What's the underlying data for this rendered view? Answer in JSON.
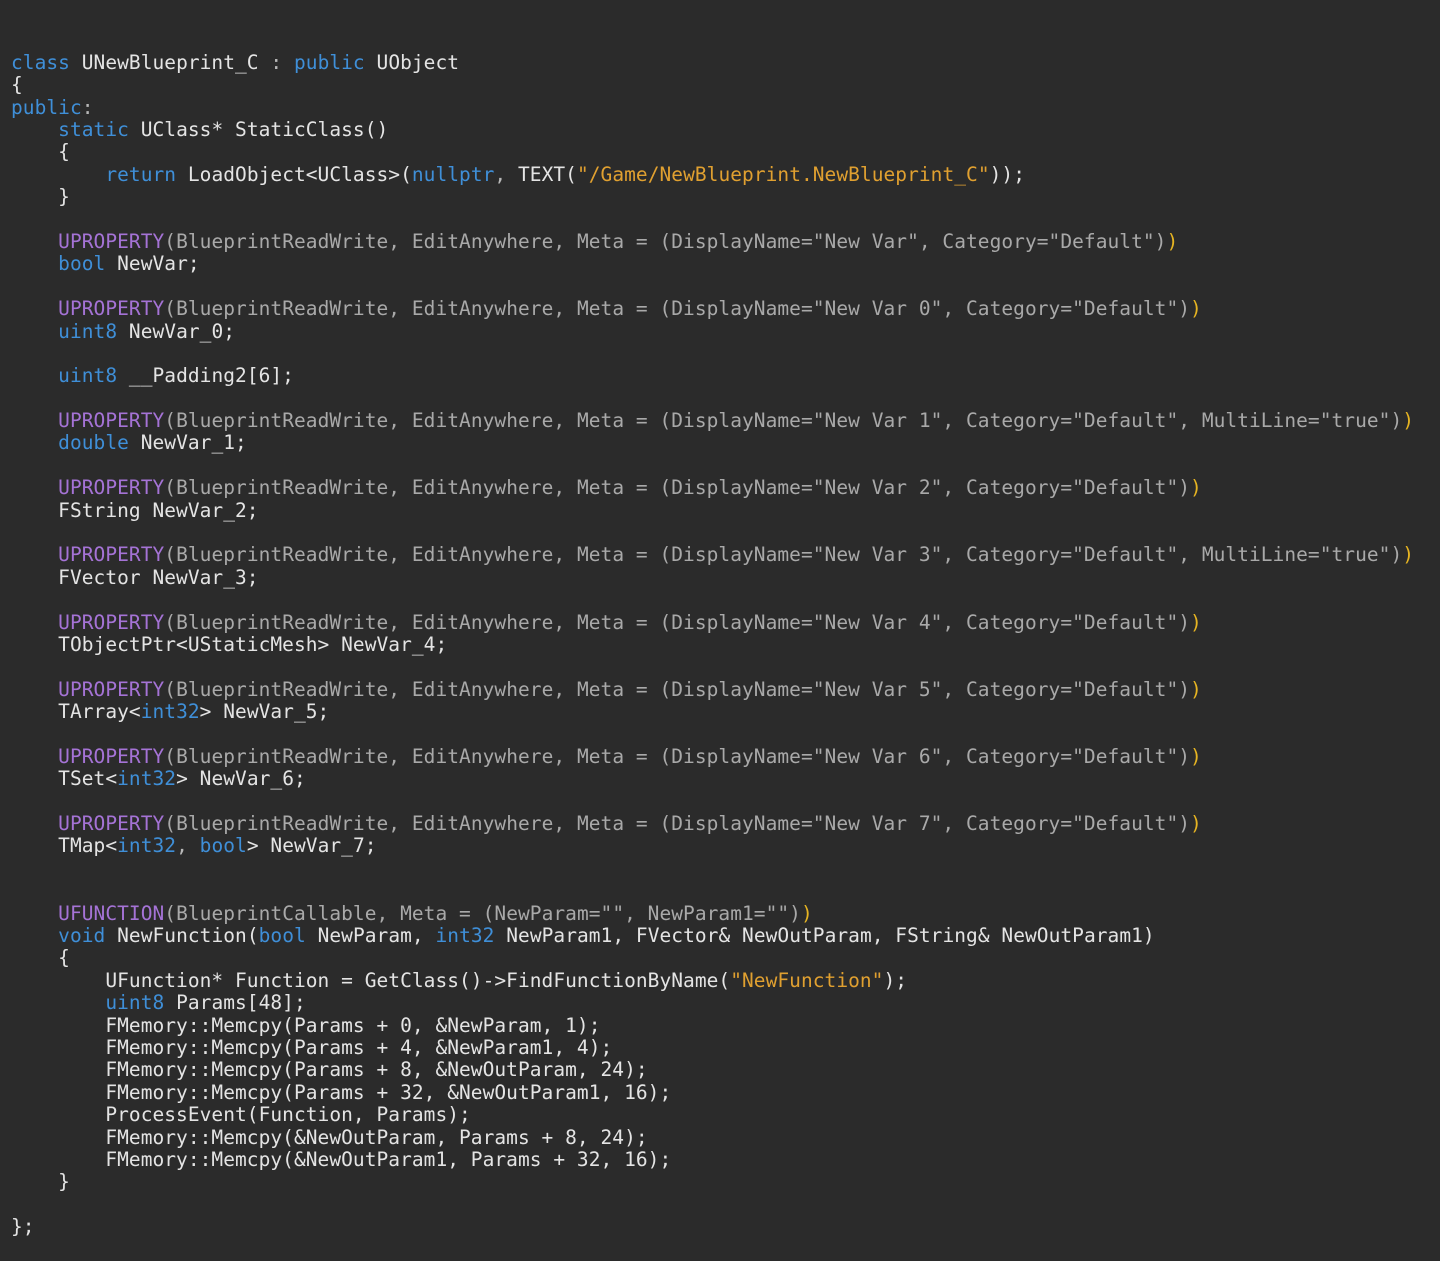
{
  "editor": {
    "background": "#2b2b2b",
    "colors": {
      "kw": "#3f8fd8",
      "macro": "#a573d6",
      "paren": "#e6b422",
      "str": "#e0a030",
      "meta": "#a9a9a9",
      "plain": "#e4e4e4",
      "punct": "#b8b8b8"
    },
    "lines": [
      [
        [
          "kw",
          "class"
        ],
        [
          "plain",
          " UNewBlueprint_C "
        ],
        [
          "punct",
          ":"
        ],
        [
          "plain",
          " "
        ],
        [
          "kw",
          "public"
        ],
        [
          "plain",
          " UObject"
        ]
      ],
      [
        [
          "plain",
          "{"
        ]
      ],
      [
        [
          "kw",
          "public"
        ],
        [
          "punct",
          ":"
        ]
      ],
      [
        [
          "plain",
          "    "
        ],
        [
          "kw",
          "static"
        ],
        [
          "plain",
          " UClass* StaticClass()"
        ]
      ],
      [
        [
          "plain",
          "    {"
        ]
      ],
      [
        [
          "plain",
          "        "
        ],
        [
          "kw",
          "return"
        ],
        [
          "plain",
          " LoadObject<UClass>("
        ],
        [
          "kw",
          "nullptr"
        ],
        [
          "punct",
          ","
        ],
        [
          "plain",
          " TEXT("
        ],
        [
          "str",
          "\"/Game/NewBlueprint.NewBlueprint_C\""
        ],
        [
          "plain",
          "));"
        ]
      ],
      [
        [
          "plain",
          "    }"
        ]
      ],
      [],
      [
        [
          "plain",
          "    "
        ],
        [
          "macro",
          "UPROPERTY"
        ],
        [
          "meta",
          "(BlueprintReadWrite, EditAnywhere, Meta = (DisplayName=\"New Var\", Category=\"Default\")"
        ],
        [
          "paren",
          ")"
        ]
      ],
      [
        [
          "plain",
          "    "
        ],
        [
          "kw",
          "bool"
        ],
        [
          "plain",
          " NewVar;"
        ]
      ],
      [],
      [
        [
          "plain",
          "    "
        ],
        [
          "macro",
          "UPROPERTY"
        ],
        [
          "meta",
          "(BlueprintReadWrite, EditAnywhere, Meta = (DisplayName=\"New Var 0\", Category=\"Default\")"
        ],
        [
          "paren",
          ")"
        ]
      ],
      [
        [
          "plain",
          "    "
        ],
        [
          "kw",
          "uint8"
        ],
        [
          "plain",
          " NewVar_0;"
        ]
      ],
      [],
      [
        [
          "plain",
          "    "
        ],
        [
          "kw",
          "uint8"
        ],
        [
          "plain",
          " __Padding2[6];"
        ]
      ],
      [],
      [
        [
          "plain",
          "    "
        ],
        [
          "macro",
          "UPROPERTY"
        ],
        [
          "meta",
          "(BlueprintReadWrite, EditAnywhere, Meta = (DisplayName=\"New Var 1\", Category=\"Default\", MultiLine=\"true\")"
        ],
        [
          "paren",
          ")"
        ]
      ],
      [
        [
          "plain",
          "    "
        ],
        [
          "kw",
          "double"
        ],
        [
          "plain",
          " NewVar_1;"
        ]
      ],
      [],
      [
        [
          "plain",
          "    "
        ],
        [
          "macro",
          "UPROPERTY"
        ],
        [
          "meta",
          "(BlueprintReadWrite, EditAnywhere, Meta = (DisplayName=\"New Var 2\", Category=\"Default\")"
        ],
        [
          "paren",
          ")"
        ]
      ],
      [
        [
          "plain",
          "    FString NewVar_2;"
        ]
      ],
      [],
      [
        [
          "plain",
          "    "
        ],
        [
          "macro",
          "UPROPERTY"
        ],
        [
          "meta",
          "(BlueprintReadWrite, EditAnywhere, Meta = (DisplayName=\"New Var 3\", Category=\"Default\", MultiLine=\"true\")"
        ],
        [
          "paren",
          ")"
        ]
      ],
      [
        [
          "plain",
          "    FVector NewVar_3;"
        ]
      ],
      [],
      [
        [
          "plain",
          "    "
        ],
        [
          "macro",
          "UPROPERTY"
        ],
        [
          "meta",
          "(BlueprintReadWrite, EditAnywhere, Meta = (DisplayName=\"New Var 4\", Category=\"Default\")"
        ],
        [
          "paren",
          ")"
        ]
      ],
      [
        [
          "plain",
          "    TObjectPtr<UStaticMesh> NewVar_4;"
        ]
      ],
      [],
      [
        [
          "plain",
          "    "
        ],
        [
          "macro",
          "UPROPERTY"
        ],
        [
          "meta",
          "(BlueprintReadWrite, EditAnywhere, Meta = (DisplayName=\"New Var 5\", Category=\"Default\")"
        ],
        [
          "paren",
          ")"
        ]
      ],
      [
        [
          "plain",
          "    TArray<"
        ],
        [
          "kw",
          "int32"
        ],
        [
          "plain",
          "> NewVar_5;"
        ]
      ],
      [],
      [
        [
          "plain",
          "    "
        ],
        [
          "macro",
          "UPROPERTY"
        ],
        [
          "meta",
          "(BlueprintReadWrite, EditAnywhere, Meta = (DisplayName=\"New Var 6\", Category=\"Default\")"
        ],
        [
          "paren",
          ")"
        ]
      ],
      [
        [
          "plain",
          "    TSet<"
        ],
        [
          "kw",
          "int32"
        ],
        [
          "plain",
          "> NewVar_6;"
        ]
      ],
      [],
      [
        [
          "plain",
          "    "
        ],
        [
          "macro",
          "UPROPERTY"
        ],
        [
          "meta",
          "(BlueprintReadWrite, EditAnywhere, Meta = (DisplayName=\"New Var 7\", Category=\"Default\")"
        ],
        [
          "paren",
          ")"
        ]
      ],
      [
        [
          "plain",
          "    TMap<"
        ],
        [
          "kw",
          "int32"
        ],
        [
          "punct",
          ","
        ],
        [
          "plain",
          " "
        ],
        [
          "kw",
          "bool"
        ],
        [
          "plain",
          "> NewVar_7;"
        ]
      ],
      [],
      [],
      [
        [
          "plain",
          "    "
        ],
        [
          "macro",
          "UFUNCTION"
        ],
        [
          "meta",
          "(BlueprintCallable, Meta = (NewParam=\"\", NewParam1=\"\")"
        ],
        [
          "paren",
          ")"
        ]
      ],
      [
        [
          "plain",
          "    "
        ],
        [
          "kw",
          "void"
        ],
        [
          "plain",
          " NewFunction("
        ],
        [
          "kw",
          "bool"
        ],
        [
          "plain",
          " NewParam, "
        ],
        [
          "kw",
          "int32"
        ],
        [
          "plain",
          " NewParam1, FVector& NewOutParam, FString& NewOutParam1)"
        ]
      ],
      [
        [
          "plain",
          "    {"
        ]
      ],
      [
        [
          "plain",
          "        UFunction* Function = GetClass()->FindFunctionByName("
        ],
        [
          "str",
          "\"NewFunction\""
        ],
        [
          "plain",
          ");"
        ]
      ],
      [
        [
          "plain",
          "        "
        ],
        [
          "kw",
          "uint8"
        ],
        [
          "plain",
          " Params[48];"
        ]
      ],
      [
        [
          "plain",
          "        FMemory::Memcpy(Params + 0, &NewParam, 1);"
        ]
      ],
      [
        [
          "plain",
          "        FMemory::Memcpy(Params + 4, &NewParam1, 4);"
        ]
      ],
      [
        [
          "plain",
          "        FMemory::Memcpy(Params + 8, &NewOutParam, 24);"
        ]
      ],
      [
        [
          "plain",
          "        FMemory::Memcpy(Params + 32, &NewOutParam1, 16);"
        ]
      ],
      [
        [
          "plain",
          "        ProcessEvent(Function, Params);"
        ]
      ],
      [
        [
          "plain",
          "        FMemory::Memcpy(&NewOutParam, Params + 8, 24);"
        ]
      ],
      [
        [
          "plain",
          "        FMemory::Memcpy(&NewOutParam1, Params + 32, 16);"
        ]
      ],
      [
        [
          "plain",
          "    }"
        ]
      ],
      [],
      [
        [
          "plain",
          "};"
        ]
      ]
    ]
  }
}
